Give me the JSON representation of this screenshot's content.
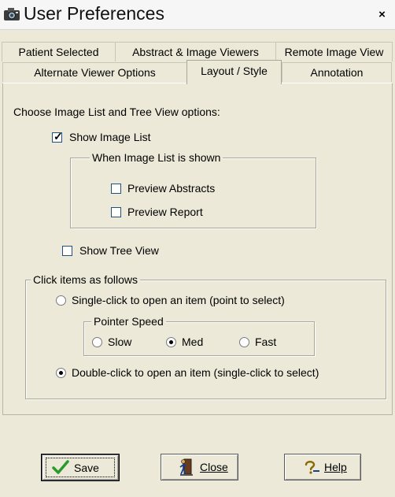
{
  "window": {
    "title": "User Preferences",
    "close_glyph": "×",
    "icon": "camera-icon"
  },
  "tabs_row1": [
    {
      "label": "Patient Selected"
    },
    {
      "label": "Abstract & Image Viewers"
    },
    {
      "label": "Remote Image View"
    }
  ],
  "tabs_row2": [
    {
      "label": "Alternate Viewer Options"
    },
    {
      "label": "Layout / Style",
      "active": true
    },
    {
      "label": "Annotation"
    }
  ],
  "panel": {
    "heading": "Choose Image List and Tree View options:",
    "show_image_list": {
      "label": "Show Image List",
      "checked": true
    },
    "image_list_group": {
      "legend": "When Image List is shown",
      "preview_abstracts": {
        "label": "Preview Abstracts",
        "checked": false
      },
      "preview_report": {
        "label": "Preview Report",
        "checked": false
      }
    },
    "show_tree_view": {
      "label": "Show Tree View",
      "checked": false
    },
    "click_group": {
      "legend": "Click items as follows",
      "single_click": {
        "label": "Single-click to open an item (point to select)",
        "selected": false
      },
      "pointer_speed": {
        "legend": "Pointer Speed",
        "options": [
          {
            "label": "Slow",
            "selected": false
          },
          {
            "label": "Med",
            "selected": true
          },
          {
            "label": "Fast",
            "selected": false
          }
        ]
      },
      "double_click": {
        "label": "Double-click to open an item (single-click to select)",
        "selected": true
      }
    }
  },
  "buttons": {
    "save": {
      "label": "Save",
      "icon": "checkmark-icon",
      "accent": "#2a9a2a"
    },
    "close": {
      "label": "Close",
      "icon": "door-exit-icon"
    },
    "help": {
      "label": "Help",
      "icon": "question-icon"
    }
  }
}
